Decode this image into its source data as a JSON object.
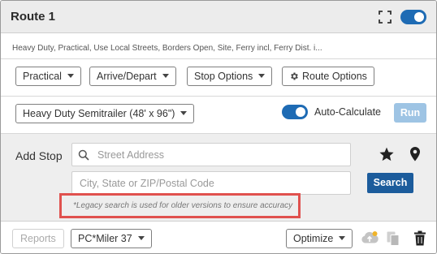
{
  "header": {
    "title": "Route 1",
    "expand_icon": "expand-icon",
    "toggle_on": true
  },
  "summary": "Heavy Duty, Practical, Use Local Streets, Borders Open, Site, Ferry incl, Ferry Dist. i...",
  "toolbar": {
    "routing_type": "Practical",
    "arrive_depart": "Arrive/Depart",
    "stop_options": "Stop Options",
    "route_options": "Route Options",
    "route_options_icon": "gear-icon"
  },
  "vehicle": {
    "profile": "Heavy Duty Semitrailer (48' x 96\")",
    "auto_calculate_label": "Auto-Calculate",
    "auto_calculate_on": true,
    "run_label": "Run"
  },
  "add_stop": {
    "label": "Add Stop",
    "street_placeholder": "Street Address",
    "city_placeholder": "City, State or ZIP/Postal Code",
    "search_label": "Search",
    "legacy_note": "*Legacy search is used for older versions to ensure accuracy",
    "favorites_icon": "star-icon",
    "map_pin_icon": "map-pin-icon"
  },
  "footer": {
    "reports_label": "Reports",
    "version": "PC*Miler 37",
    "optimize_label": "Optimize",
    "cloud_icon": "cloud-upload-icon",
    "copy_icon": "copy-icon",
    "delete_icon": "trash-icon"
  },
  "colors": {
    "accent": "#1e6bb4",
    "search_button": "#1c5c9c",
    "run_disabled": "#9ec4e4",
    "highlight": "#e0514e"
  }
}
